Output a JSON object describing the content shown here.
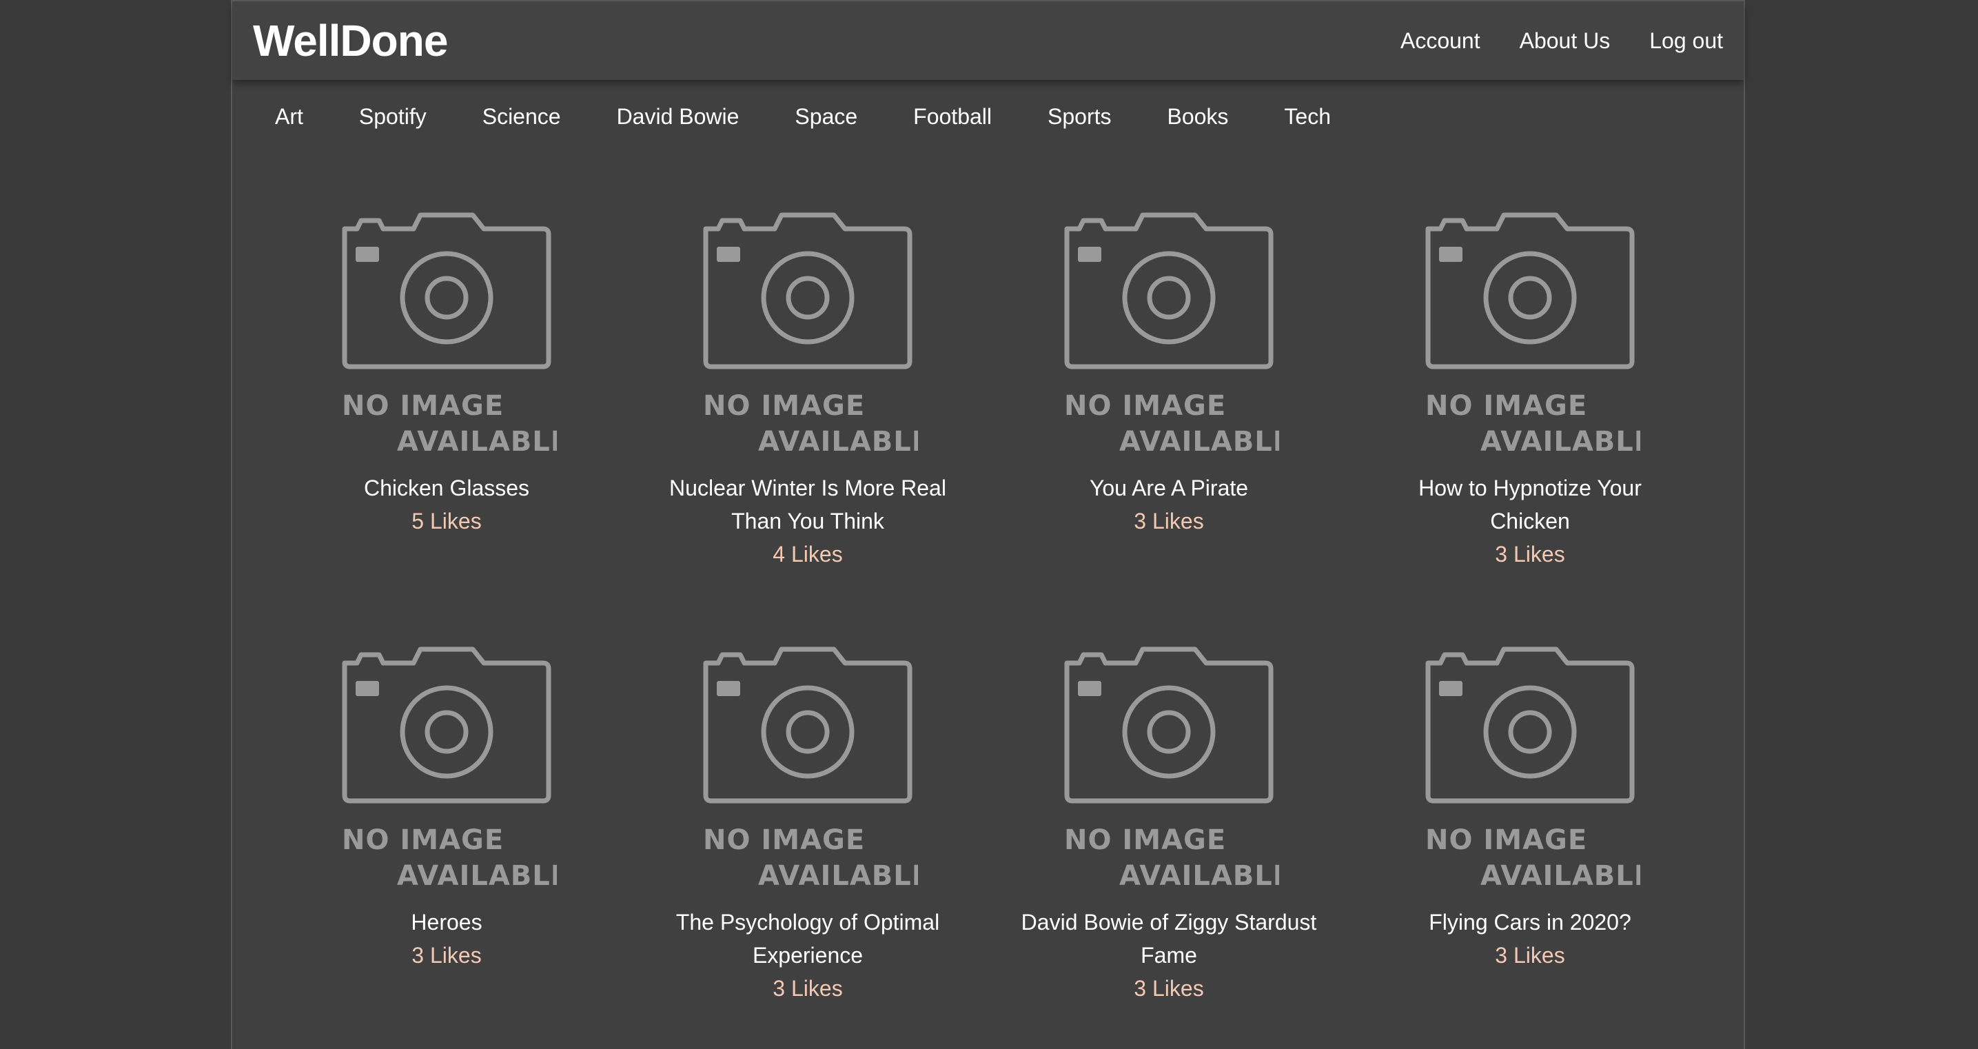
{
  "header": {
    "logo": "WellDone",
    "links": [
      "Account",
      "About Us",
      "Log out"
    ]
  },
  "categories": [
    "Art",
    "Spotify",
    "Science",
    "David Bowie",
    "Space",
    "Football",
    "Sports",
    "Books",
    "Tech"
  ],
  "placeholder": {
    "line1": "NO IMAGE",
    "line2": "AVAILABLE"
  },
  "posts": [
    {
      "title": "Chicken Glasses",
      "likes": "5 Likes"
    },
    {
      "title": "Nuclear Winter Is More Real Than You Think",
      "likes": "4 Likes"
    },
    {
      "title": "You Are A Pirate",
      "likes": "3 Likes"
    },
    {
      "title": "How to Hypnotize Your Chicken",
      "likes": "3 Likes"
    },
    {
      "title": "Heroes",
      "likes": "3 Likes"
    },
    {
      "title": "The Psychology of Optimal Experience",
      "likes": "3 Likes"
    },
    {
      "title": "David Bowie of Ziggy Stardust Fame",
      "likes": "3 Likes"
    },
    {
      "title": "Flying Cars in 2020?",
      "likes": "3 Likes"
    }
  ],
  "colors": {
    "background": "#3a3a3a",
    "panel": "#404040",
    "likes": "#f3c9b4",
    "placeholder": "#9a9a9a"
  }
}
